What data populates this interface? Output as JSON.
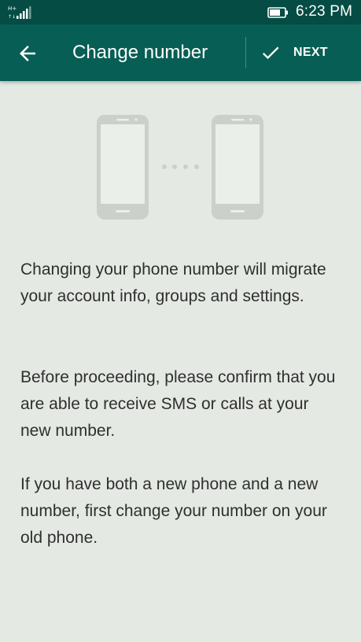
{
  "status_bar": {
    "network": "H+",
    "time": "6:23 PM"
  },
  "toolbar": {
    "title": "Change number",
    "next_label": "NEXT",
    "back_icon": "arrow-back-icon",
    "next_icon": "checkmark-icon"
  },
  "colors": {
    "status_bar": "#054d44",
    "toolbar": "#075e54",
    "background": "#e5e9e4",
    "illustration": "#cbd0ca"
  },
  "content": {
    "paragraphs": [
      "Changing your phone number will migrate your account info, groups and settings.",
      "Before proceeding, please confirm that you are able to receive SMS or calls at your new number.",
      "If you have both a new phone and a new number, first change your number on your old phone."
    ]
  }
}
